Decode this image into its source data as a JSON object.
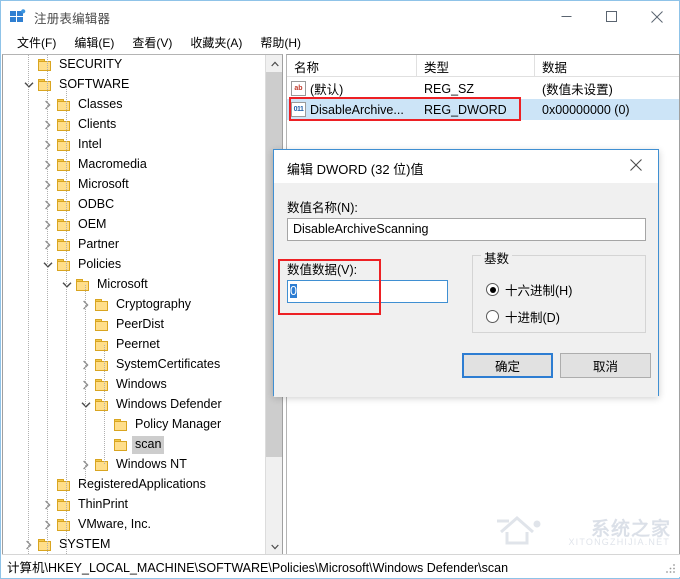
{
  "window": {
    "title": "注册表编辑器",
    "icon": "registry-editor-icon",
    "minimize_label": "最小化",
    "maximize_label": "最大化",
    "close_label": "关闭"
  },
  "menu": {
    "items": [
      {
        "label": "文件(F)",
        "name": "menu-file"
      },
      {
        "label": "编辑(E)",
        "name": "menu-edit"
      },
      {
        "label": "查看(V)",
        "name": "menu-view"
      },
      {
        "label": "收藏夹(A)",
        "name": "menu-favorites"
      },
      {
        "label": "帮助(H)",
        "name": "menu-help"
      }
    ]
  },
  "tree": {
    "items": [
      {
        "label": "SECURITY",
        "indent": 1,
        "expander": "none",
        "selected": false
      },
      {
        "label": "SOFTWARE",
        "indent": 1,
        "expander": "expanded",
        "selected": false
      },
      {
        "label": "Classes",
        "indent": 2,
        "expander": "collapsed",
        "selected": false
      },
      {
        "label": "Clients",
        "indent": 2,
        "expander": "collapsed",
        "selected": false
      },
      {
        "label": "Intel",
        "indent": 2,
        "expander": "collapsed",
        "selected": false
      },
      {
        "label": "Macromedia",
        "indent": 2,
        "expander": "collapsed",
        "selected": false
      },
      {
        "label": "Microsoft",
        "indent": 2,
        "expander": "collapsed",
        "selected": false
      },
      {
        "label": "ODBC",
        "indent": 2,
        "expander": "collapsed",
        "selected": false
      },
      {
        "label": "OEM",
        "indent": 2,
        "expander": "collapsed",
        "selected": false
      },
      {
        "label": "Partner",
        "indent": 2,
        "expander": "collapsed",
        "selected": false
      },
      {
        "label": "Policies",
        "indent": 2,
        "expander": "expanded",
        "selected": false
      },
      {
        "label": "Microsoft",
        "indent": 3,
        "expander": "expanded",
        "selected": false
      },
      {
        "label": "Cryptography",
        "indent": 4,
        "expander": "collapsed",
        "selected": false
      },
      {
        "label": "PeerDist",
        "indent": 4,
        "expander": "none",
        "selected": false
      },
      {
        "label": "Peernet",
        "indent": 4,
        "expander": "none",
        "selected": false
      },
      {
        "label": "SystemCertificates",
        "indent": 4,
        "expander": "collapsed",
        "selected": false
      },
      {
        "label": "Windows",
        "indent": 4,
        "expander": "collapsed",
        "selected": false
      },
      {
        "label": "Windows Defender",
        "indent": 4,
        "expander": "expanded",
        "selected": false
      },
      {
        "label": "Policy Manager",
        "indent": 5,
        "expander": "none",
        "selected": false
      },
      {
        "label": "scan",
        "indent": 5,
        "expander": "none",
        "selected": true
      },
      {
        "label": "Windows NT",
        "indent": 4,
        "expander": "collapsed",
        "selected": false
      },
      {
        "label": "RegisteredApplications",
        "indent": 2,
        "expander": "none",
        "selected": false
      },
      {
        "label": "ThinPrint",
        "indent": 2,
        "expander": "collapsed",
        "selected": false
      },
      {
        "label": "VMware, Inc.",
        "indent": 2,
        "expander": "collapsed",
        "selected": false
      },
      {
        "label": "SYSTEM",
        "indent": 1,
        "expander": "collapsed",
        "selected": false
      }
    ],
    "scrollbar": {
      "up_arrow": "scroll-up",
      "down_arrow": "scroll-down"
    }
  },
  "list": {
    "columns": [
      "名称",
      "类型",
      "数据"
    ],
    "rows": [
      {
        "icon": "string-value-icon",
        "icon_text": "ab",
        "name": "(默认)",
        "type": "REG_SZ",
        "data": "(数值未设置)",
        "selected": false
      },
      {
        "icon": "dword-value-icon",
        "icon_text": "011",
        "name": "DisableArchive...",
        "type": "REG_DWORD",
        "data": "0x00000000 (0)",
        "selected": true
      }
    ]
  },
  "dialog": {
    "title": "编辑 DWORD (32 位)值",
    "close_label": "关闭",
    "value_name_label": "数值名称(N):",
    "value_name": "DisableArchiveScanning",
    "value_data_label": "数值数据(V):",
    "value_data": "0",
    "base_group_label": "基数",
    "radios": [
      {
        "label": "十六进制(H)",
        "checked": true
      },
      {
        "label": "十进制(D)",
        "checked": false
      }
    ],
    "ok_label": "确定",
    "cancel_label": "取消"
  },
  "statusbar": {
    "path": "计算机\\HKEY_LOCAL_MACHINE\\SOFTWARE\\Policies\\Microsoft\\Windows Defender\\scan"
  },
  "watermark": {
    "text": "系统之家",
    "subtext": "XITONGZHIJIA.NET"
  },
  "colors": {
    "accent_blue": "#3f8fd2",
    "selection_blue": "#cce4f7",
    "annotation_red": "#ed2024",
    "folder_yellow": "#ffde8a",
    "tree_selection_gray": "#cdcdcd"
  }
}
